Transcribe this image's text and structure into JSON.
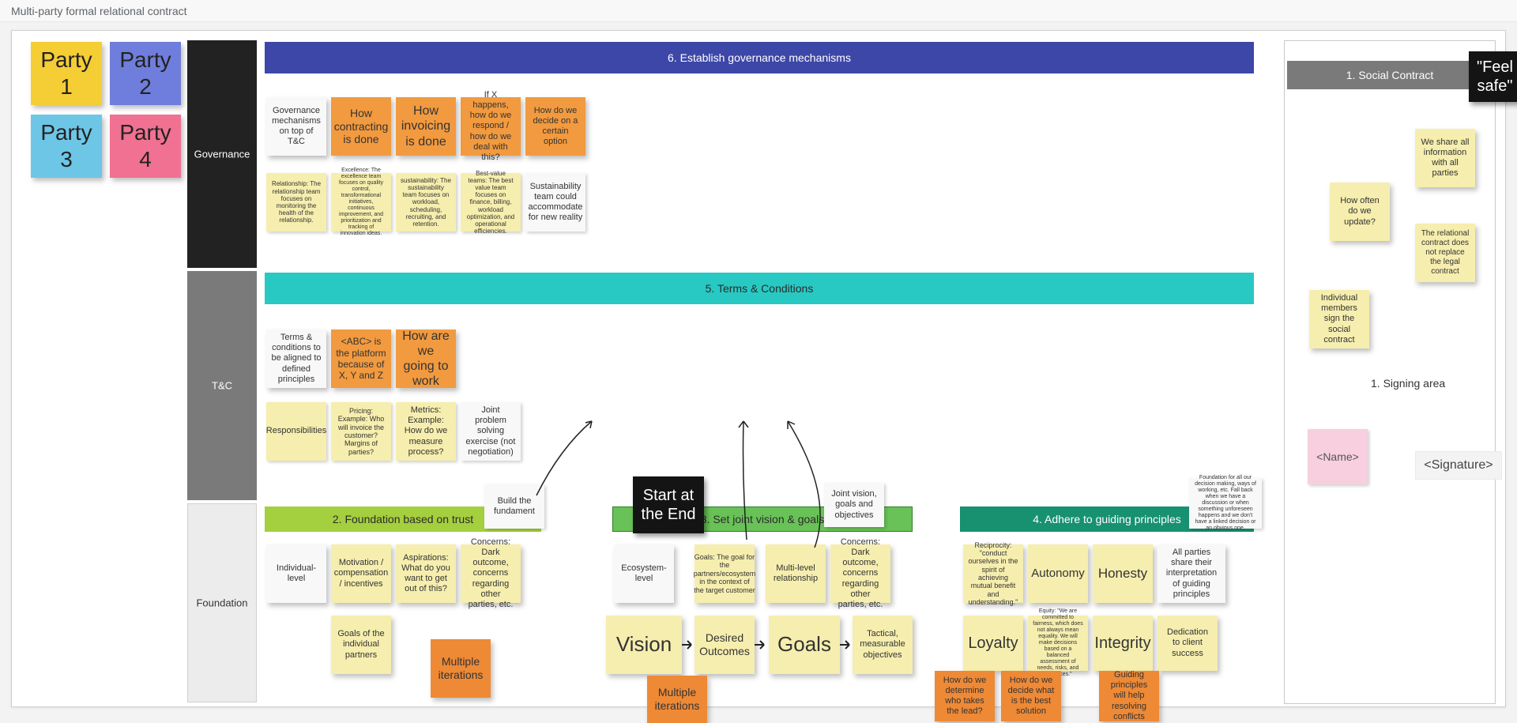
{
  "title": "Multi-party formal relational contract",
  "parties": {
    "p1": "Party 1",
    "p2": "Party 2",
    "p3": "Party 3",
    "p4": "Party 4"
  },
  "labels": {
    "gov": "Governance",
    "tc": "T&C",
    "foundation": "Foundation"
  },
  "banners": {
    "gov": "6. Establish governance mechanisms",
    "tc": "5. Terms & Conditions",
    "found": "2. Foundation based on trust",
    "vision": "3. Set joint vision & goals",
    "principles": "4. Adhere to guiding principles",
    "social": "1. Social Contract"
  },
  "gov_row1": {
    "a": "Governance mechanisms on top of T&C",
    "b": "How contracting is done",
    "c": "How invoicing is done",
    "d": "If X happens, how do we respond / how do we deal with this?",
    "e": "How do we decide on a certain option"
  },
  "gov_row2": {
    "a": "Relationship: The relationship team focuses on monitoring the health of the relationship.",
    "b": "Excellence: The excellence team focuses on quality control, transformational initiatives, continuous improvement, and prioritization and tracking of innovation ideas.",
    "c": "sustainability: The sustainability team focuses on workload, scheduling, recruiting, and retention.",
    "d": "Best-value teams: The best value team focuses on finance, billing, workload optimization, and operational efficiencies.",
    "e": "Sustainability team could accommodate for new reality"
  },
  "tc_row1": {
    "a": "Terms & conditions to be aligned to defined principles",
    "b": "<ABC> is the platform because of X, Y and Z",
    "c": "How are we going to work"
  },
  "tc_row2": {
    "a": "Responsibilities",
    "b": "Pricing: Example: Who will invoice the customer? Margins of parties?",
    "c": "Metrics: Example: How do we measure process?",
    "d": "Joint problem solving exercise (not negotiation)"
  },
  "found1": {
    "callout": "Build the fundament",
    "a": "Individual-level",
    "b": "Motivation / compensation / incentives",
    "c": "Aspirations: What do you want to get out of this?",
    "d": "Concerns: Dark outcome, concerns regarding other parties, etc.",
    "e": "Goals of the individual partners",
    "f": "Multiple iterations"
  },
  "vision": {
    "start": "Start at the End",
    "callout": "Joint vision, goals and objectives",
    "a": "Ecosystem-level",
    "b": "Goals: The goal for the partners/ecosystem in the context of the target customer",
    "c": "Multi-level relationship",
    "d": "Concerns: Dark outcome, concerns regarding other parties, etc.",
    "v": "Vision",
    "do": "Desired Outcomes",
    "g": "Goals",
    "tmo": "Tactical, measurable objectives",
    "mi": "Multiple iterations"
  },
  "principles": {
    "callout": "Foundation for all our decision making, ways of working, etc. Fall back when we have a discussion or when something unforeseen happens and we don't have a linked decision or an obvious one.",
    "rec": "Reciprocity: \"conduct ourselves in the spirit of achieving mutual benefit and understanding.\"",
    "aut": "Autonomy",
    "hon": "Honesty",
    "interp": "All parties share their interpretation of guiding principles",
    "loy": "Loyalty",
    "eq": "Equity: \"We are committed to fairness, which does not always mean equality. We will make decisions based on a balanced assessment of needs, risks, and resources.\"",
    "int": "Integrity",
    "ded": "Dedication to client success",
    "lead": "How do we determine who takes the lead?",
    "best": "How do we decide what is the best solution",
    "help": "Guiding principles will help resolving conflicts"
  },
  "side": {
    "feel": "\"Feel safe\"",
    "share": "We share all information with all parties",
    "upd": "How often do we update?",
    "legal": "The relational contract does not replace the legal contract",
    "sign": "Individual members sign the social contract",
    "area": "1. Signing area",
    "name": "<Name>",
    "sig": "<Signature>"
  }
}
